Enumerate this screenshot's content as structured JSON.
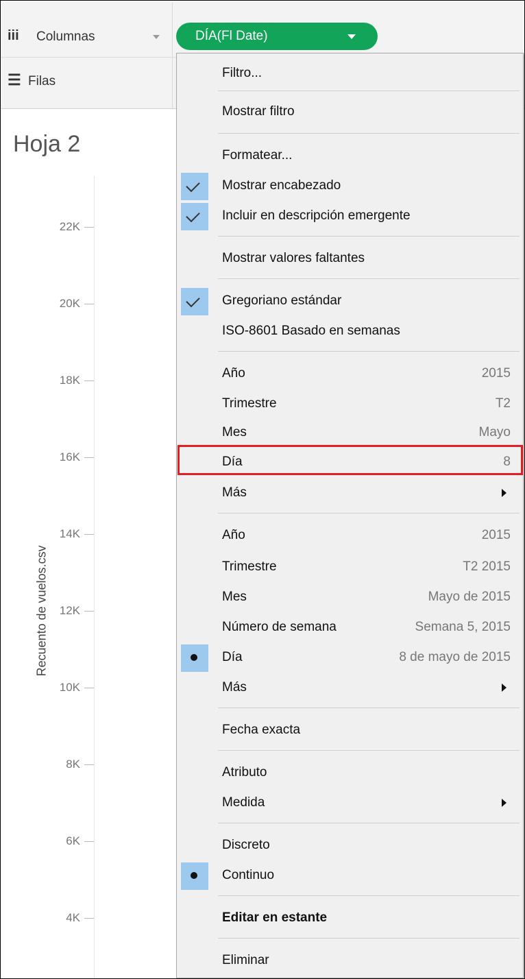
{
  "shelves": {
    "columns_label": "Columnas",
    "rows_label": "Filas"
  },
  "pill": {
    "label": "DÍA(Fl Date)"
  },
  "sheet": {
    "title": "Hoja 2"
  },
  "axis": {
    "title": "Recuento de vuelos.csv",
    "ticks": [
      "22K",
      "20K",
      "18K",
      "16K",
      "14K",
      "12K",
      "10K",
      "8K",
      "6K",
      "4K"
    ]
  },
  "menu": {
    "items": {
      "filtro": "Filtro...",
      "mostrar_filtro": "Mostrar filtro",
      "formatear": "Formatear...",
      "mostrar_encabezado": "Mostrar encabezado",
      "incluir_descripcion": "Incluir en descripción emergente",
      "mostrar_valores_faltantes": "Mostrar valores faltantes",
      "gregoriano": "Gregoriano estándar",
      "iso8601": "ISO-8601 Basado en semanas",
      "anio1": {
        "label": "Año",
        "value": "2015"
      },
      "trimestre1": {
        "label": "Trimestre",
        "value": "T2"
      },
      "mes1": {
        "label": "Mes",
        "value": "Mayo"
      },
      "dia1": {
        "label": "Día",
        "value": "8"
      },
      "mas1": "Más",
      "anio2": {
        "label": "Año",
        "value": "2015"
      },
      "trimestre2": {
        "label": "Trimestre",
        "value": "T2 2015"
      },
      "mes2": {
        "label": "Mes",
        "value": "Mayo de 2015"
      },
      "semana": {
        "label": "Número de semana",
        "value": "Semana 5, 2015"
      },
      "dia2": {
        "label": "Día",
        "value": "8 de mayo de 2015"
      },
      "mas2": "Más",
      "fecha_exacta": "Fecha exacta",
      "atributo": "Atributo",
      "medida": "Medida",
      "discreto": "Discreto",
      "continuo": "Continuo",
      "editar_estante": "Editar en estante",
      "eliminar": "Eliminar"
    }
  },
  "colors": {
    "pill": "#12a459",
    "highlight": "#e31e24",
    "checked_bg": "#9ec9ee"
  }
}
